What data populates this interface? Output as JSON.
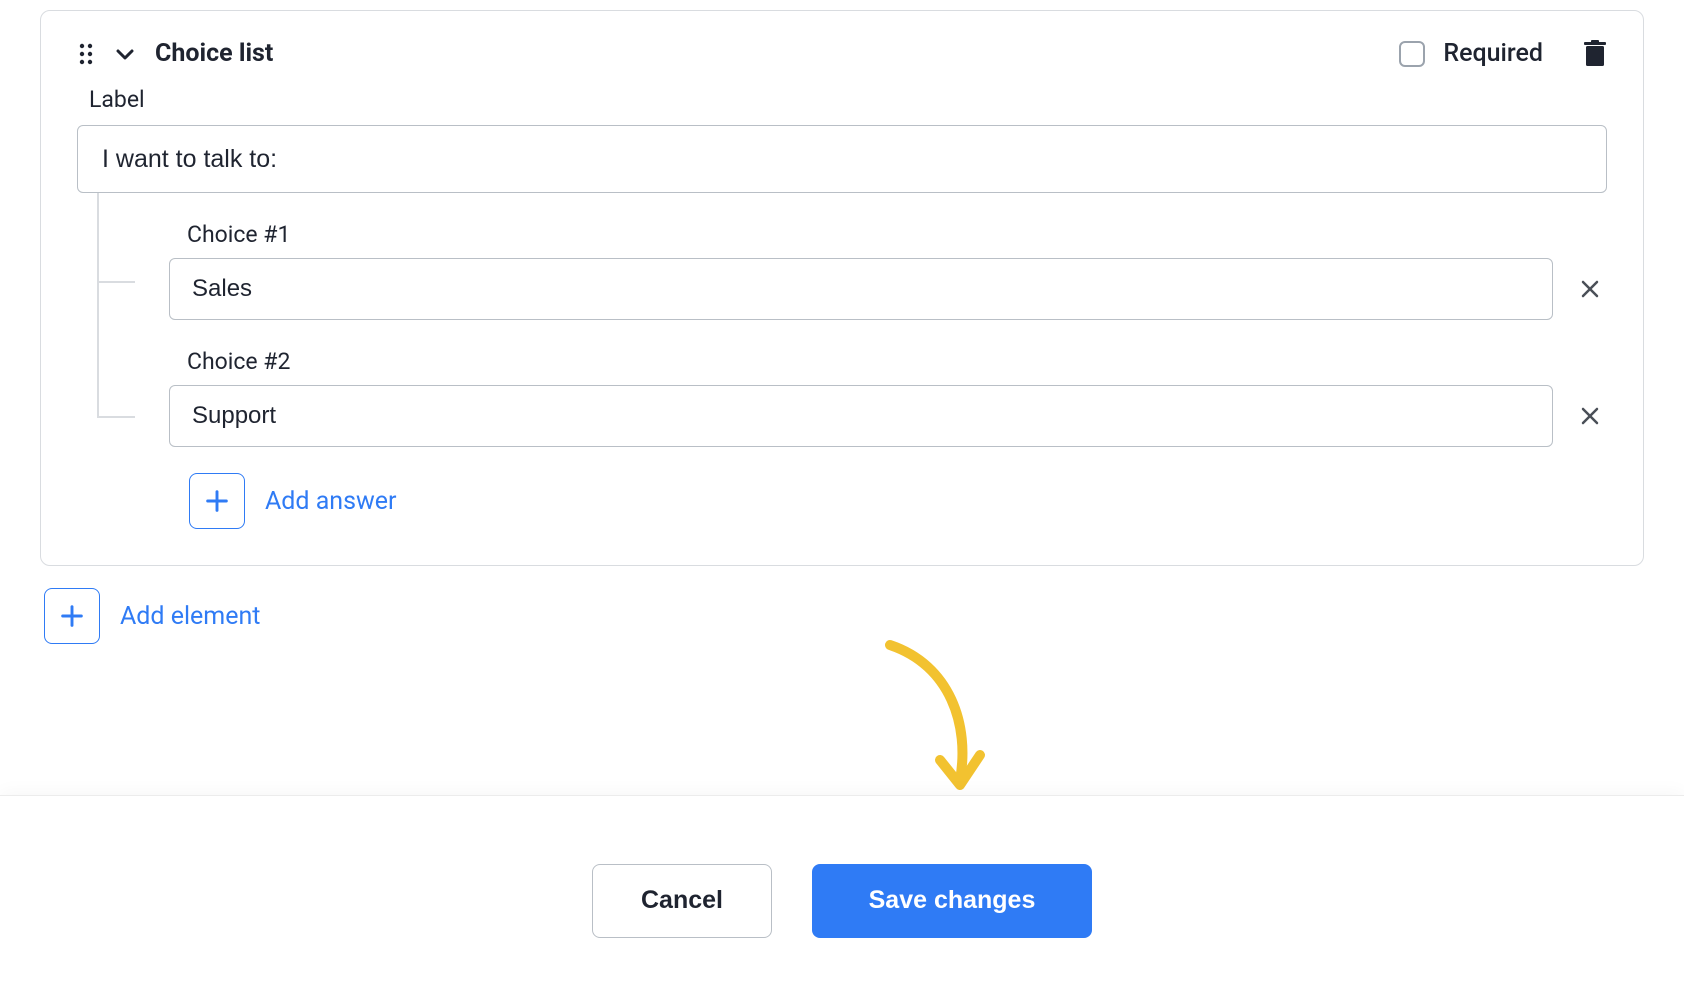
{
  "element": {
    "type_label": "Choice list",
    "required_label": "Required",
    "required_checked": false,
    "label_field_label": "Label",
    "label_value": "I want to talk to:",
    "choices": [
      {
        "caption": "Choice #1",
        "value": "Sales"
      },
      {
        "caption": "Choice #2",
        "value": "Support"
      }
    ],
    "add_answer_label": "Add answer"
  },
  "add_element_label": "Add element",
  "footer": {
    "cancel_label": "Cancel",
    "save_label": "Save changes"
  }
}
